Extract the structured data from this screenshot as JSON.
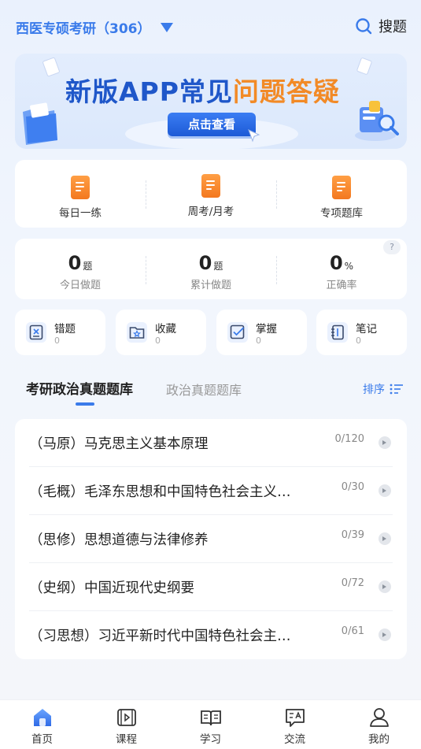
{
  "header": {
    "subject": "西医专硕考研（306）",
    "search_label": "搜题"
  },
  "banner": {
    "title_main": "新版APP常见",
    "title_highlight": "问题答疑",
    "button": "点击查看"
  },
  "practice": [
    {
      "label": "每日一练"
    },
    {
      "label": "周考/月考"
    },
    {
      "label": "专项题库"
    }
  ],
  "stats": {
    "today": {
      "value": "0",
      "unit": "题",
      "label": "今日做题"
    },
    "total": {
      "value": "0",
      "unit": "题",
      "label": "累计做题"
    },
    "accuracy": {
      "value": "0",
      "unit": "%",
      "label": "正确率"
    },
    "help": "?"
  },
  "mini_cards": [
    {
      "label": "错题",
      "count": "0"
    },
    {
      "label": "收藏",
      "count": "0"
    },
    {
      "label": "掌握",
      "count": "0"
    },
    {
      "label": "笔记",
      "count": "0"
    }
  ],
  "tabs": {
    "active": "考研政治真题题库",
    "inactive": "政治真题题库",
    "sort": "排序"
  },
  "subjects": [
    {
      "name": "（马原）马克思主义基本原理",
      "count": "0/120"
    },
    {
      "name": "（毛概）毛泽东思想和中国特色社会主义…",
      "count": "0/30"
    },
    {
      "name": "（思修）思想道德与法律修养",
      "count": "0/39"
    },
    {
      "name": "（史纲）中国近现代史纲要",
      "count": "0/72"
    },
    {
      "name": "（习思想）习近平新时代中国特色社会主…",
      "count": "0/61"
    }
  ],
  "nav": [
    {
      "label": "首页"
    },
    {
      "label": "课程"
    },
    {
      "label": "学习"
    },
    {
      "label": "交流"
    },
    {
      "label": "我的"
    }
  ],
  "colors": {
    "accent": "#3a7bea",
    "orange": "#f3781f"
  }
}
